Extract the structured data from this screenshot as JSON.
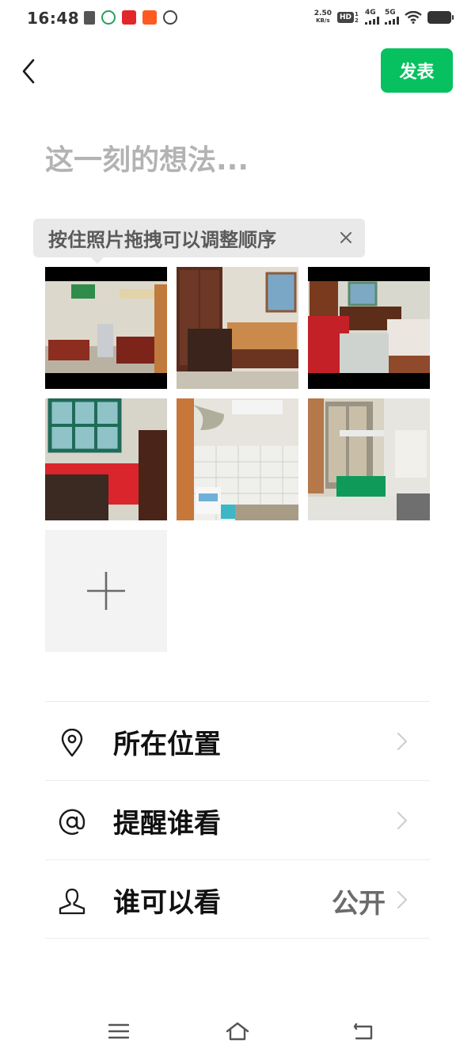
{
  "status_bar": {
    "time": "16:48",
    "net_speed_value": "2.50",
    "net_speed_unit": "KB/s",
    "hd_badge": "HD",
    "hd_sub": "1 2",
    "signal_1_label": "4G",
    "signal_2_label": "5G",
    "notification_icons": [
      "sim-icon",
      "shield-app-icon",
      "red-app-icon",
      "taobao-icon",
      "link-app-icon"
    ]
  },
  "header": {
    "publish_label": "发表"
  },
  "composer": {
    "placeholder": "这一刻的想法...",
    "value": ""
  },
  "tooltip": {
    "text": "按住照片拖拽可以调整顺序"
  },
  "photos": [
    {
      "name": "living-room-photo"
    },
    {
      "name": "bedroom-wardrobe-photo"
    },
    {
      "name": "bedroom-sofa-photo"
    },
    {
      "name": "red-bed-photo"
    },
    {
      "name": "bathroom-photo"
    },
    {
      "name": "kitchen-photo"
    }
  ],
  "menu": {
    "location_label": "所在位置",
    "mention_label": "提醒谁看",
    "visibility_label": "谁可以看",
    "visibility_value": "公开"
  },
  "colors": {
    "accent": "#07c160",
    "placeholder": "#b3b3b3"
  }
}
